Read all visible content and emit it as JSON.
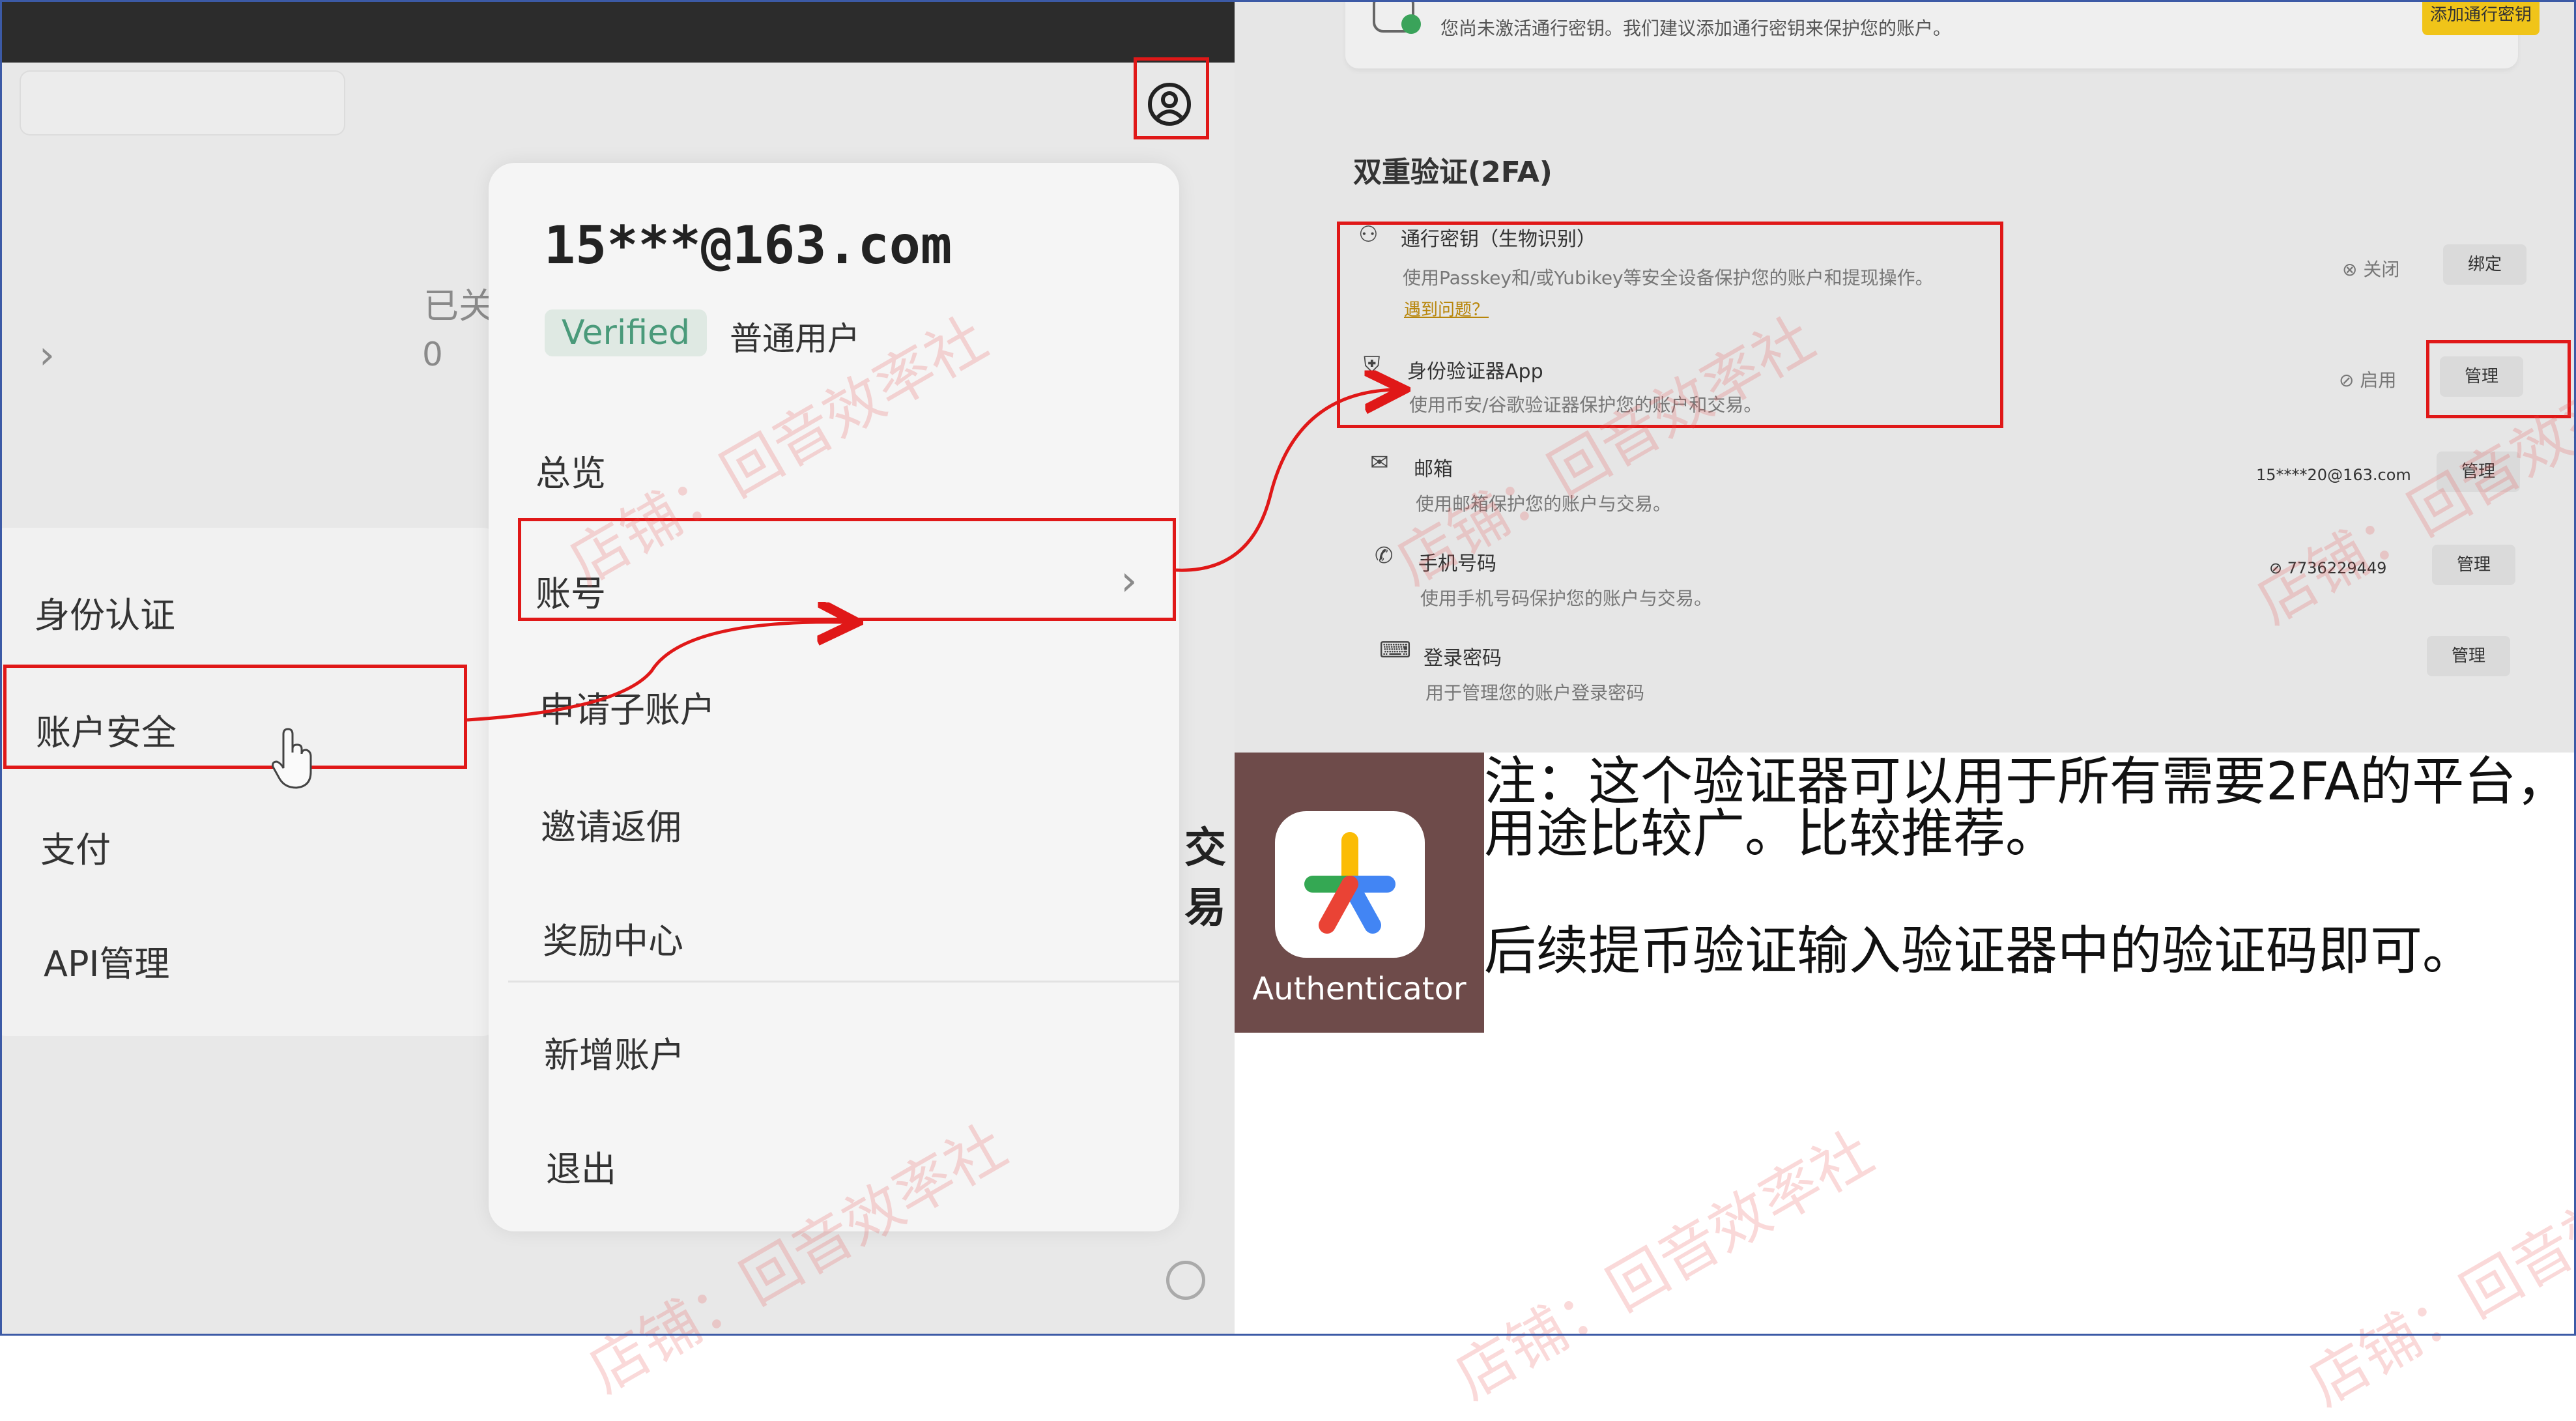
{
  "left_panel": {
    "email": "15***@163.com",
    "verified_badge": "Verified",
    "user_type": "普通用户",
    "side_text_1": "已关",
    "side_text_2": "0",
    "side_text_3": "交易",
    "sidebar_items": [
      "身份认证",
      "账户安全",
      "支付",
      "API管理"
    ],
    "menu_items": [
      "总览",
      "账号",
      "申请子账户",
      "邀请返佣",
      "奖励中心",
      "新增账户",
      "退出"
    ],
    "chevron": "›"
  },
  "right_panel": {
    "banner_text": "您尚未激活通行密钥。我们建议添加通行密钥来保护您的账户。",
    "banner_button": "添加通行密钥",
    "section_title": "双重验证(2FA)",
    "rows": [
      {
        "icon": "passkey-icon",
        "title": "通行密钥（生物识别）",
        "desc": "使用Passkey和/或Yubikey等安全设备保护您的账户和提现操作。",
        "link": "遇到问题？",
        "status": "关闭",
        "value": "",
        "button": "绑定"
      },
      {
        "icon": "shield-icon",
        "title": "身份验证器App",
        "desc": "使用币安/谷歌验证器保护您的账户和交易。",
        "link": "",
        "status": "启用",
        "value": "",
        "button": "管理"
      },
      {
        "icon": "mail-icon",
        "title": "邮箱",
        "desc": "使用邮箱保护您的账户与交易。",
        "link": "",
        "status": "",
        "value": "15****20@163.com",
        "button": "管理"
      },
      {
        "icon": "phone-icon",
        "title": "手机号码",
        "desc": "使用手机号码保护您的账户与交易。",
        "link": "",
        "status": "",
        "value": "7736229449",
        "button": "管理"
      },
      {
        "icon": "password-icon",
        "title": "登录密码",
        "desc": "用于管理您的账户登录密码",
        "link": "",
        "status": "",
        "value": "",
        "button": "管理"
      }
    ]
  },
  "authenticator": {
    "label": "Authenticator"
  },
  "note": {
    "line1": "注：这个验证器可以用于所有需要2FA的平台，",
    "line2": "用途比较广。比较推荐。",
    "line3": "后续提币验证输入验证器中的验证码即可。"
  },
  "watermark": "店铺：回音效率社",
  "colors": {
    "highlight": "#e01818",
    "frame": "#3c5aa6",
    "verified": "#4a9a7a"
  }
}
